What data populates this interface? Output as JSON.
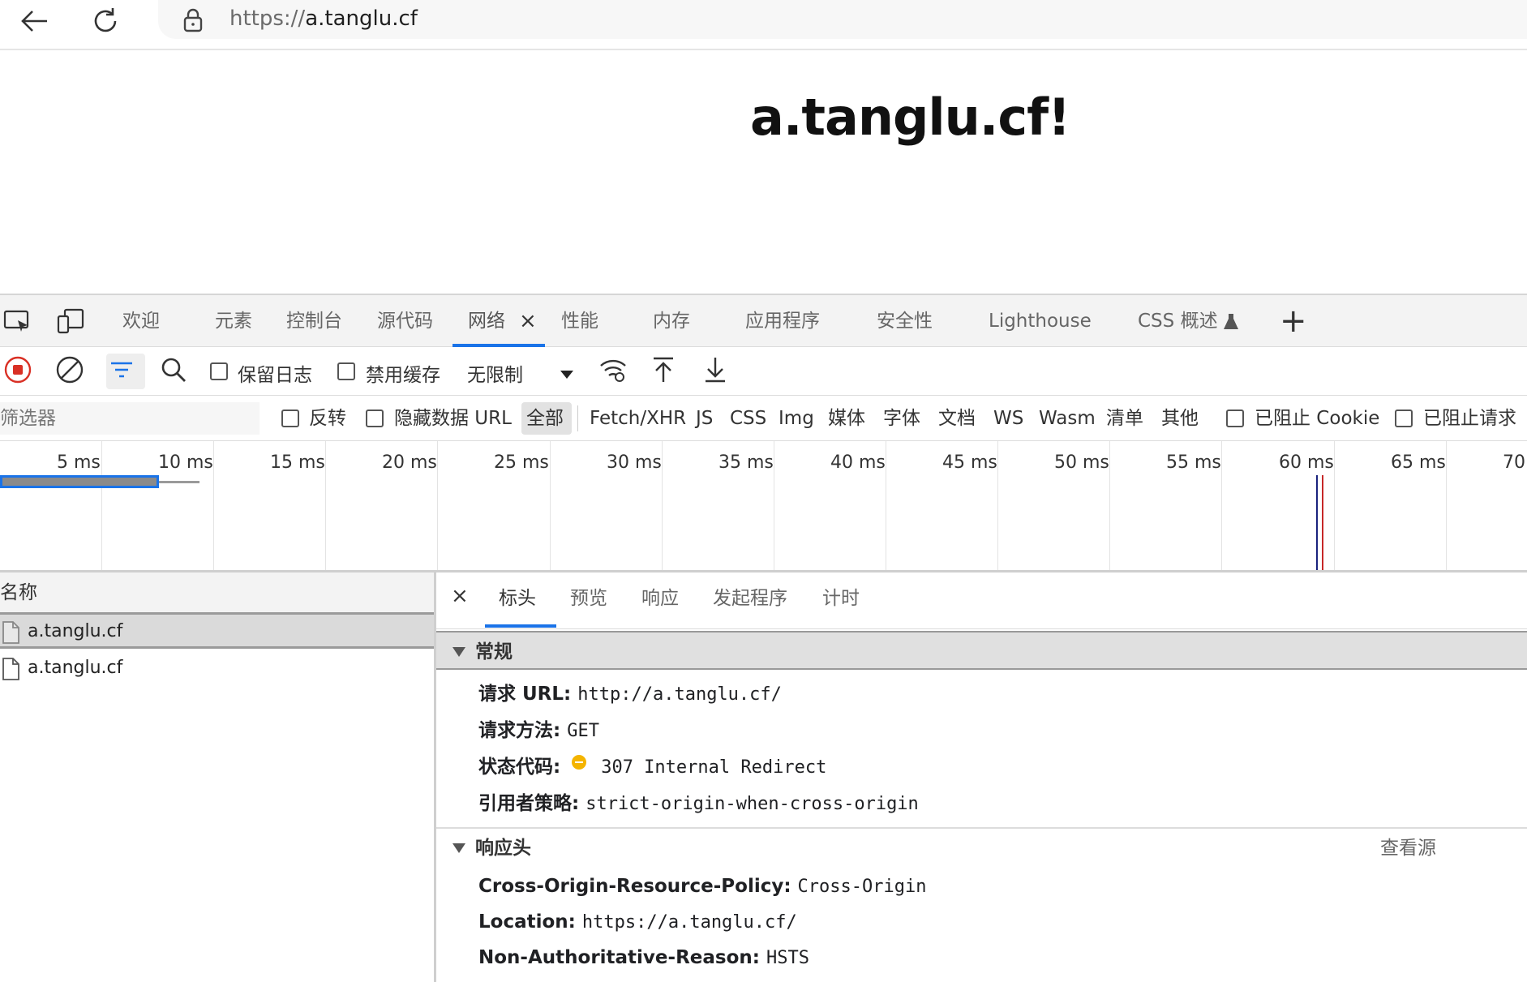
{
  "browser": {
    "url_scheme": "https://",
    "url_host": "a.tanglu.cf",
    "back_icon": "arrow-left-icon",
    "reload_icon": "refresh-icon",
    "lock_icon": "lock-icon"
  },
  "page": {
    "heading": "a.tanglu.cf!"
  },
  "devtools": {
    "tabs": [
      {
        "label": "欢迎"
      },
      {
        "label": "元素"
      },
      {
        "label": "控制台"
      },
      {
        "label": "源代码"
      },
      {
        "label": "网络"
      },
      {
        "label": "性能"
      },
      {
        "label": "内存"
      },
      {
        "label": "应用程序"
      },
      {
        "label": "安全性"
      },
      {
        "label": "Lighthouse"
      },
      {
        "label": "CSS 概述"
      }
    ],
    "active_tab": "网络",
    "close_glyph": "×",
    "plus_glyph": "+",
    "toolbar": {
      "preserve_log": "保留日志",
      "disable_cache": "禁用缓存",
      "throttle_value": "无限制"
    },
    "filter": {
      "placeholder": "筛选器",
      "invert": "反转",
      "hide_data_urls": "隐藏数据 URL",
      "types": [
        "全部",
        "Fetch/XHR",
        "JS",
        "CSS",
        "Img",
        "媒体",
        "字体",
        "文档",
        "WS",
        "Wasm",
        "清单",
        "其他"
      ],
      "blocked_cookies": "已阻止 Cookie",
      "blocked_requests": "已阻止请求"
    },
    "timeline": {
      "ticks": [
        "5 ms",
        "10 ms",
        "15 ms",
        "20 ms",
        "25 ms",
        "30 ms",
        "35 ms",
        "40 ms",
        "45 ms",
        "50 ms",
        "55 ms",
        "60 ms",
        "65 ms",
        "70"
      ],
      "dom_content_loaded_ms": 61.3,
      "load_ms": 61.6
    },
    "requests": {
      "column_name": "名称",
      "rows": [
        {
          "name": "a.tanglu.cf"
        },
        {
          "name": "a.tanglu.cf"
        }
      ]
    },
    "details": {
      "tabs": [
        "标头",
        "预览",
        "响应",
        "发起程序",
        "计时"
      ],
      "general": {
        "title": "常规",
        "request_url_label": "请求 URL:",
        "request_url": "http://a.tanglu.cf/",
        "method_label": "请求方法:",
        "method": "GET",
        "status_label": "状态代码:",
        "status": "307 Internal Redirect",
        "status_color": "#f4b400",
        "referrer_label": "引用者策略:",
        "referrer": "strict-origin-when-cross-origin"
      },
      "response_headers": {
        "title": "响应头",
        "view_source": "查看源",
        "corp_label": "Cross-Origin-Resource-Policy:",
        "corp": "Cross-Origin",
        "location_label": "Location:",
        "location": "https://a.tanglu.cf/",
        "nar_label": "Non-Authoritative-Reason:",
        "nar": "HSTS"
      }
    }
  },
  "colors": {
    "accent": "#1a73e8",
    "record_red": "#d93025",
    "dcl_line": "#1a237e",
    "load_line": "#c62828"
  }
}
